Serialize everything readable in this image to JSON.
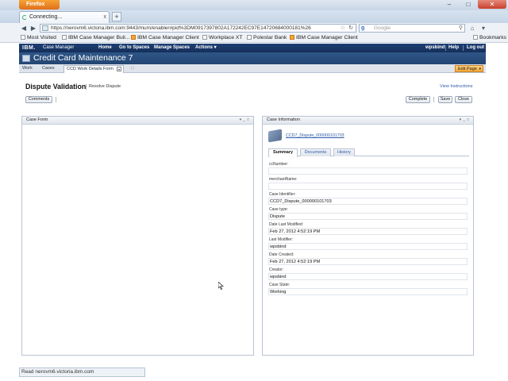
{
  "browser": {
    "menu_button": "Firefox",
    "tab": {
      "title": "Connecting...",
      "close": "x"
    },
    "new_tab": "+",
    "url": "https://nerovm6.victoria.ibm.com:9443/mum/enabler#pid%3DM0917397802A172242EC97E1472068400018​1%26",
    "search_placeholder": "Google",
    "bookmarks": [
      "Most Visited",
      "IBM Case Manager Buil...",
      "IBM Case Manager Client",
      "Workplace XT",
      "Polestar Bank",
      "IBM Case Manager Client"
    ],
    "bookmarks_right": "Bookmarks",
    "status": "Read nerovm6.victoria.ibm.com"
  },
  "app": {
    "brand": "IBM.",
    "product": "Case Manager",
    "nav": {
      "home": "Home",
      "spaces": "Go to Spaces",
      "manage": "Manage Spaces",
      "actions": "Actions ▾",
      "user": "wpsbind",
      "help": "Help",
      "logout": "Log out"
    },
    "space_title": "Credit Card Maintenance 7",
    "page_tabs": {
      "work": "Work",
      "cases": "Cases",
      "form": "CCD Work Details Form",
      "edit_page": "Edit Page"
    },
    "page": {
      "title": "Dispute Validation",
      "subtitle": "Resolve Dispute",
      "view_instructions": "View Instructions",
      "buttons": {
        "comments": "Comments",
        "complete": "Complete",
        "save": "Save",
        "close": "Close"
      }
    },
    "case_form": {
      "title": "Case Form"
    },
    "case_info": {
      "title": "Case Information",
      "case_id_link": "CCD7_Dispute_000000101703",
      "tabs": [
        "Summary",
        "Documents",
        "History"
      ],
      "fields": [
        {
          "label": "ccNumber:",
          "value": ""
        },
        {
          "label": "merchantName:",
          "value": ""
        },
        {
          "label": "Case Identifier:",
          "value": "CCD7_Dispute_000000101703"
        },
        {
          "label": "Case type:",
          "value": "Dispute"
        },
        {
          "label": "Date Last Modified:",
          "value": "Feb 27, 2012 4:52:19 PM"
        },
        {
          "label": "Last Modifier:",
          "value": "wpsbind"
        },
        {
          "label": "Date Created:",
          "value": "Feb 27, 2012 4:52:19 PM"
        },
        {
          "label": "Creator:",
          "value": "wpsbind"
        },
        {
          "label": "Case State:",
          "value": "Working"
        }
      ]
    }
  }
}
